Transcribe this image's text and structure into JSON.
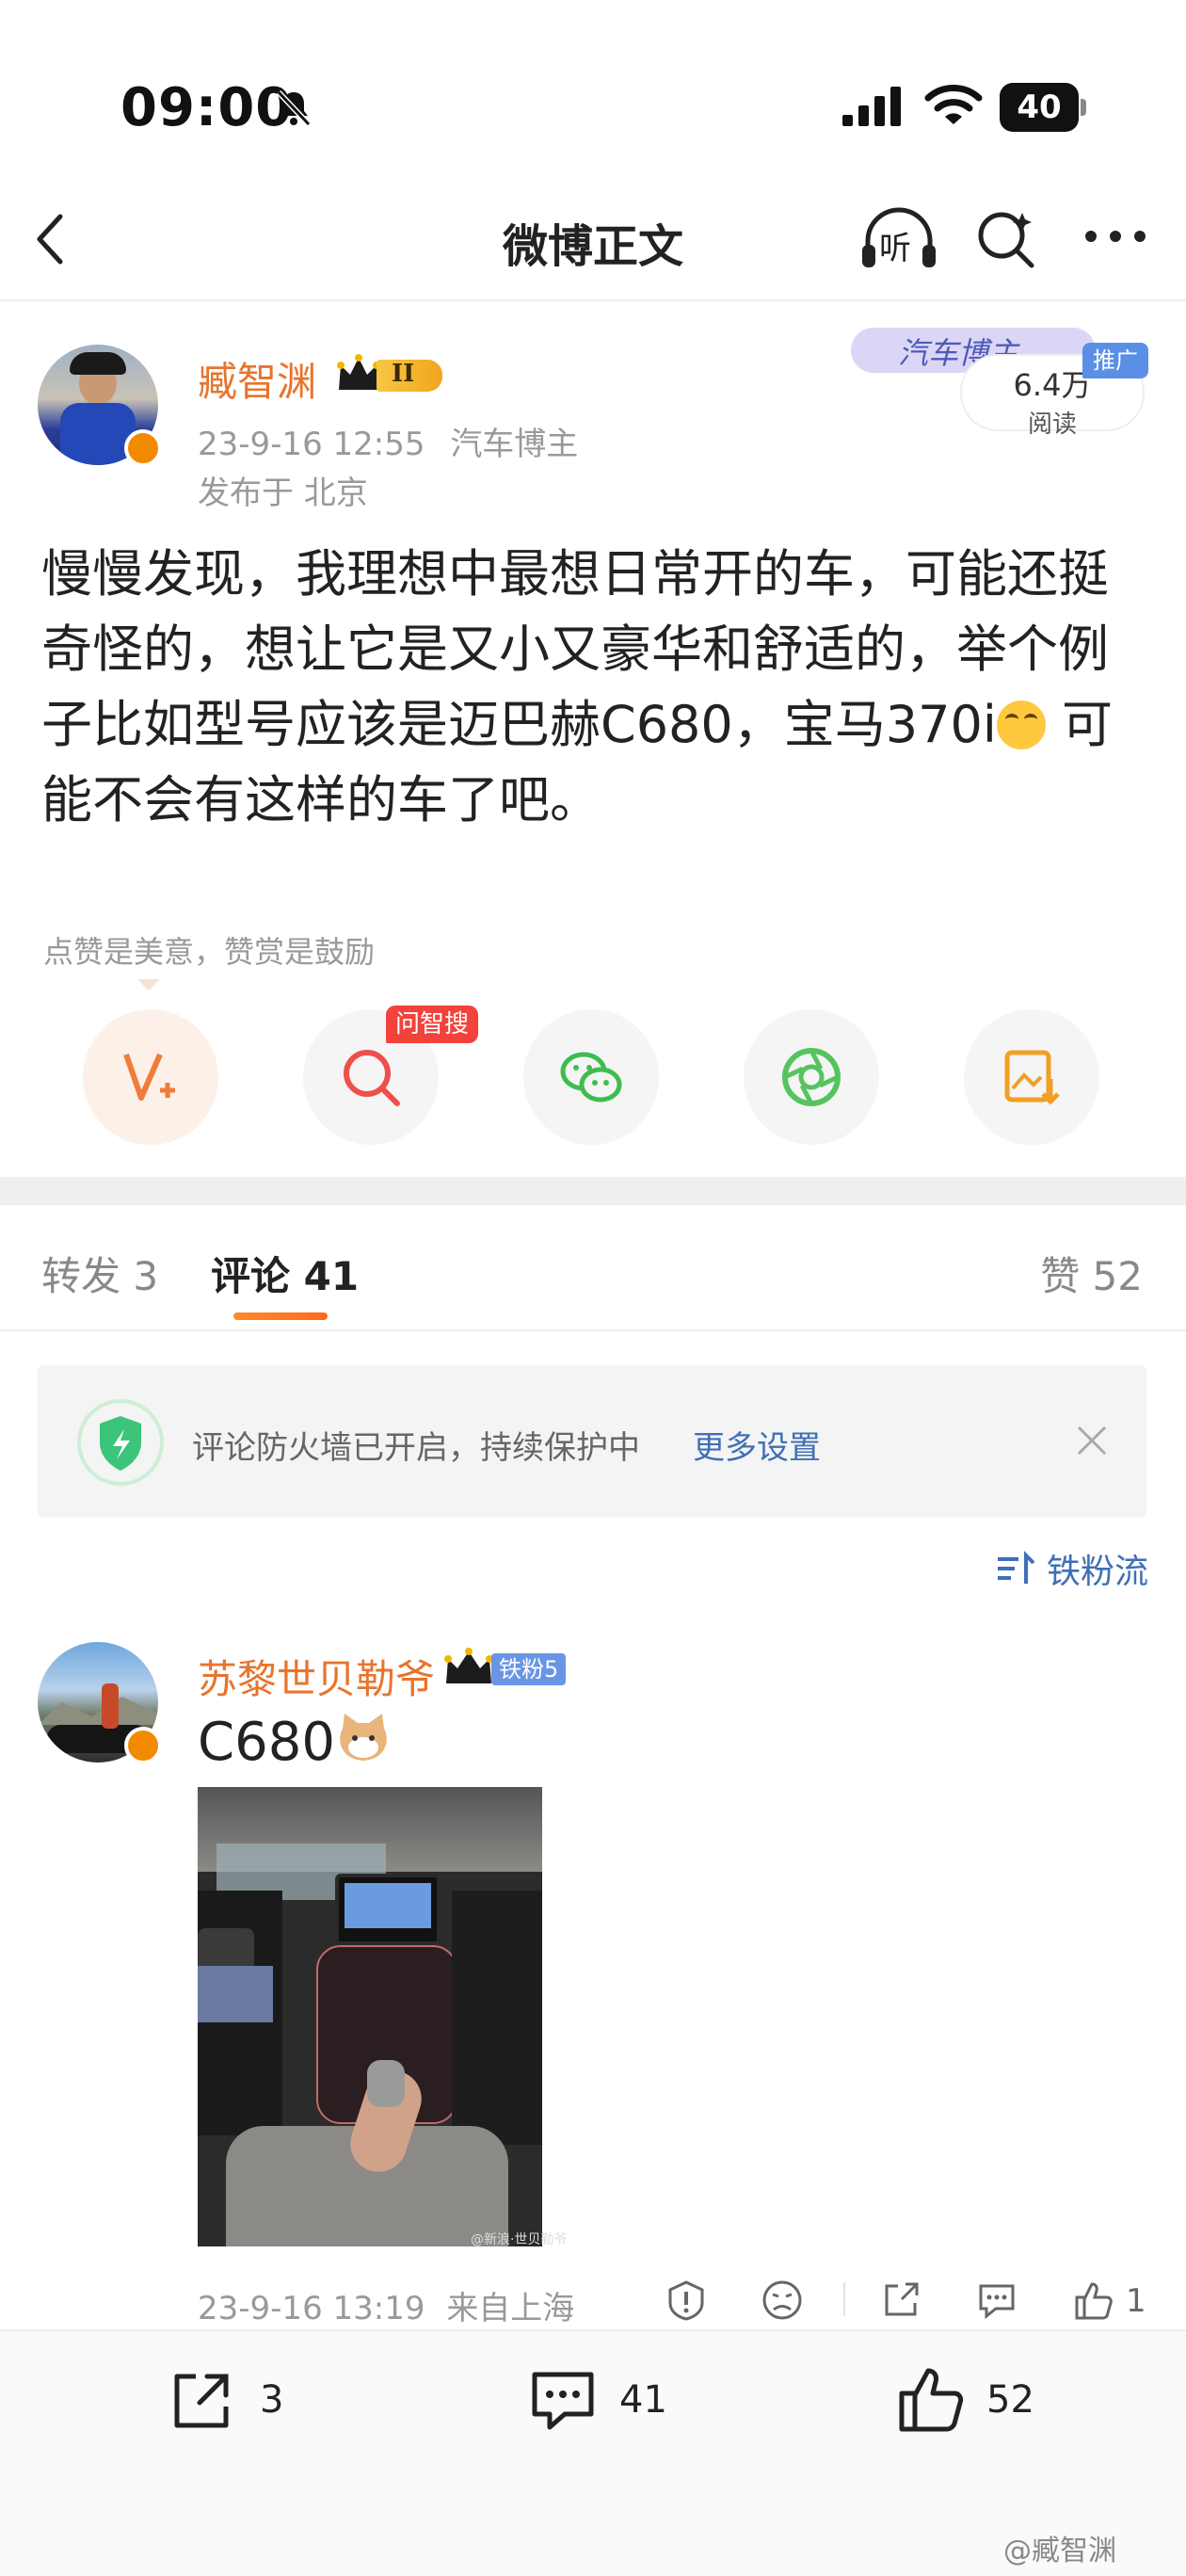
{
  "status_bar": {
    "time": "09:00",
    "battery": "40"
  },
  "nav": {
    "title": "微博正文",
    "listen_label": "听"
  },
  "post": {
    "author_name": "臧智渊",
    "level_badge": "II",
    "date": "23-9-16 12:55",
    "author_title": "汽车博主",
    "location": "发布于 北京",
    "topic_tag": "汽车博主",
    "views_count": "6.4万",
    "views_label": "阅读",
    "promo_badge": "推广",
    "text_main": "慢慢发现，我理想中最想日常开的车，可能还挺奇怪的，想让它是又小又豪华和舒适的，举个例子比如型号应该是迈巴赫C680，宝马370i",
    "text_tail": " 可能不会有这样的车了吧。",
    "reward_hint": "点赞是美意，赞赏是鼓励",
    "ask_badge": "问智搜"
  },
  "tabs": {
    "reposts": "转发 3",
    "comments": "评论 41",
    "likes": "赞 52"
  },
  "firewall": {
    "text": "评论防火墙已开启，持续保护中",
    "link": "更多设置"
  },
  "sort": {
    "label": "铁粉流"
  },
  "comment": {
    "author_name": "苏黎世贝勒爷",
    "fan_badge": "铁粉5",
    "text": "C680",
    "photo_caption": "@新浪·世贝勒爷",
    "date": "23-9-16 13:19",
    "source": "来自上海",
    "like_count": "1"
  },
  "bottom_bar": {
    "reposts": "3",
    "comments": "41",
    "likes": "52"
  },
  "watermark": "@臧智渊",
  "colors": {
    "accent_orange": "#e8742e",
    "link_blue": "#3f6fb5",
    "tab_underline": "#ff7a22"
  }
}
